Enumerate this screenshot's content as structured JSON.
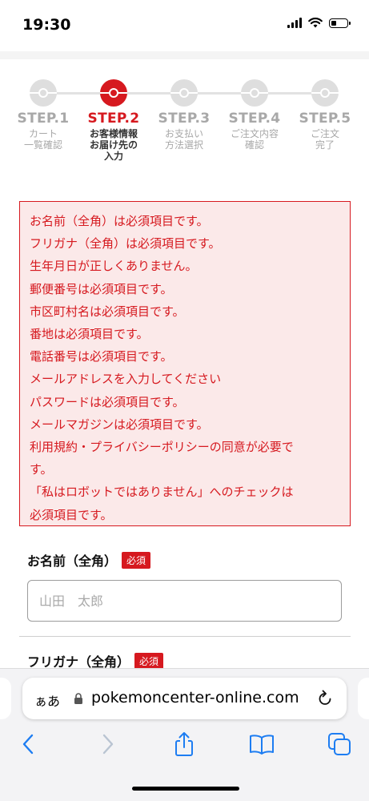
{
  "status": {
    "time": "19:30",
    "battery_level": 0.35
  },
  "steps": [
    {
      "label": "STEP.1",
      "desc": [
        "カート",
        "一覧確認"
      ],
      "active": false
    },
    {
      "label": "STEP.2",
      "desc": [
        "お客様情報",
        "お届け先の",
        "入力"
      ],
      "active": true
    },
    {
      "label": "STEP.3",
      "desc": [
        "お支払い",
        "方法選択"
      ],
      "active": false
    },
    {
      "label": "STEP.4",
      "desc": [
        "ご注文内容",
        "確認"
      ],
      "active": false
    },
    {
      "label": "STEP.5",
      "desc": [
        "ご注文",
        "完了"
      ],
      "active": false
    }
  ],
  "errors": [
    "お名前（全角）は必須項目です。",
    "フリガナ（全角）は必須項目です。",
    "生年月日が正しくありません。",
    "郵便番号は必須項目です。",
    "市区町村名は必須項目です。",
    "番地は必須項目です。",
    "電話番号は必須項目です。",
    "メールアドレスを入力してください",
    "パスワードは必須項目です。",
    "メールマガジンは必須項目です。",
    "利用規約・プライバシーポリシーの同意が必要で",
    "す。",
    "「私はロボットではありません」へのチェックは",
    "必須項目です。"
  ],
  "form": {
    "name_label": "お名前（全角）",
    "required_badge": "必須",
    "name_placeholder": "山田　太郎",
    "name_value": "",
    "kana_label": "フリガナ（全角）"
  },
  "browser": {
    "aa": "ぁあ",
    "url": "pokemoncenter-online.com"
  },
  "colors": {
    "accent": "#d6191f",
    "error_bg": "#fbe9e9",
    "inactive": "#a8a8a8"
  }
}
